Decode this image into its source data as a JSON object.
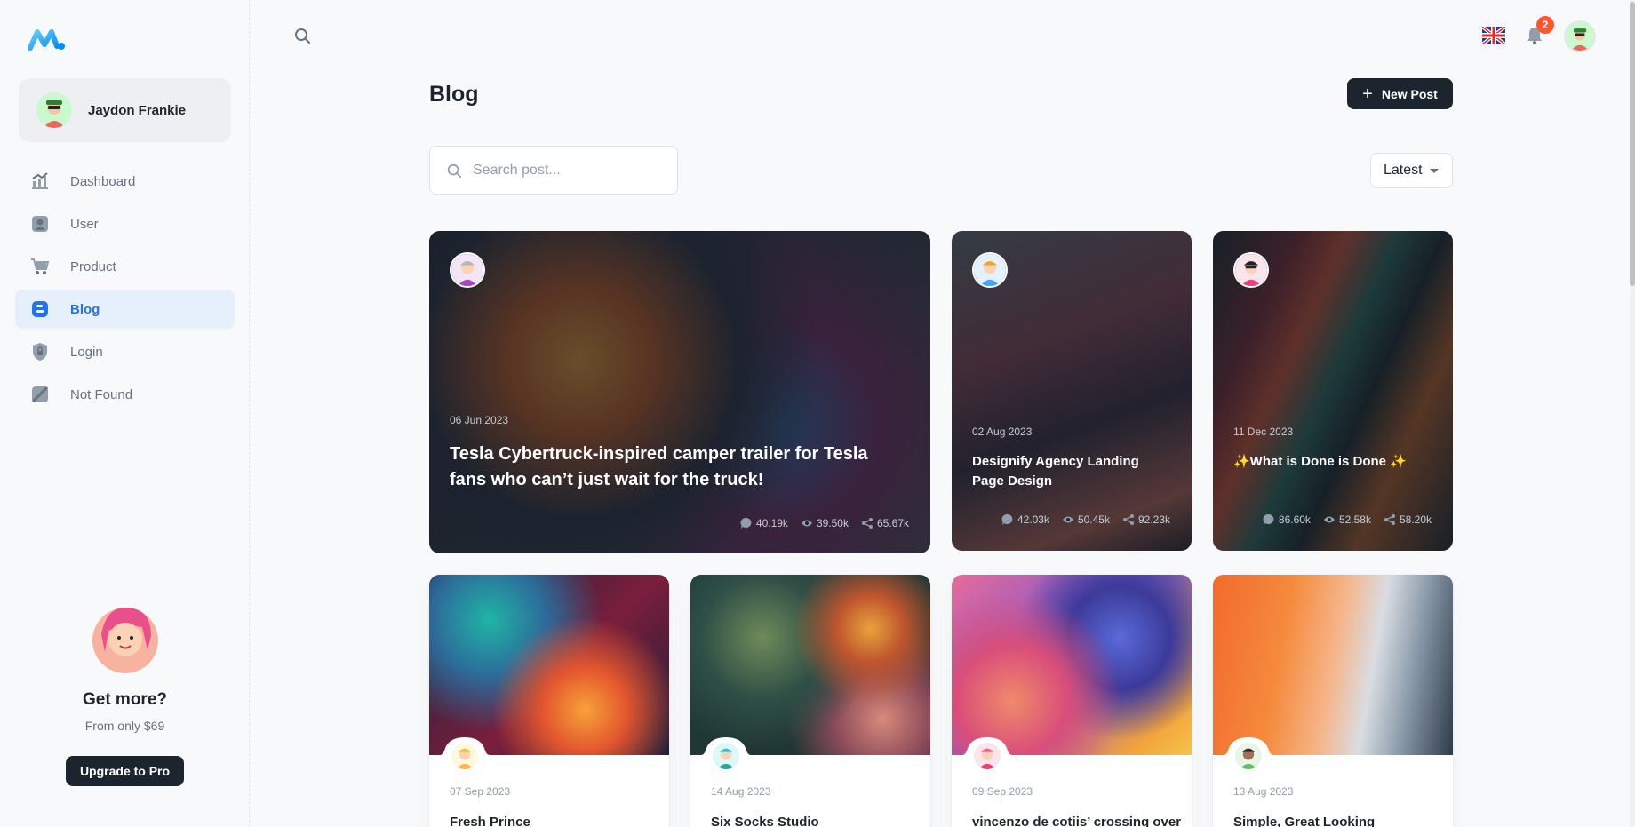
{
  "app": {
    "logo_name": "logo-icon"
  },
  "account": {
    "name": "Jaydon Frankie"
  },
  "sidebar": {
    "items": [
      {
        "label": "Dashboard",
        "icon": "chart-icon"
      },
      {
        "label": "User",
        "icon": "user-icon"
      },
      {
        "label": "Product",
        "icon": "cart-icon"
      },
      {
        "label": "Blog",
        "icon": "blog-icon",
        "active": true
      },
      {
        "label": "Login",
        "icon": "lock-icon"
      },
      {
        "label": "Not Found",
        "icon": "disabled-icon"
      }
    ]
  },
  "promo": {
    "heading": "Get more?",
    "subtext": "From only $69",
    "button_label": "Upgrade to Pro"
  },
  "header": {
    "notifications_count": "2"
  },
  "page": {
    "title": "Blog",
    "new_post_label": "New Post",
    "search_placeholder": "Search post...",
    "sort_value": "Latest"
  },
  "featured": [
    {
      "date": "06 Jun 2023",
      "title": "Tesla Cybertruck-inspired camper trailer for Tesla fans who can’t just wait for the truck!",
      "comments": "40.19k",
      "views": "39.50k",
      "shares": "65.67k"
    },
    {
      "date": "02 Aug 2023",
      "title": "Designify Agency Landing Page Design",
      "comments": "42.03k",
      "views": "50.45k",
      "shares": "92.23k"
    },
    {
      "date": "11 Dec 2023",
      "title": "✨What is Done is Done ✨",
      "comments": "86.60k",
      "views": "52.58k",
      "shares": "58.20k"
    }
  ],
  "posts": [
    {
      "date": "07 Sep 2023",
      "title": "Fresh Prince"
    },
    {
      "date": "14 Aug 2023",
      "title": "Six Socks Studio"
    },
    {
      "date": "09 Sep 2023",
      "title": "vincenzo de cotiis’ crossing over"
    },
    {
      "date": "13 Aug 2023",
      "title": "Simple, Great Looking"
    }
  ],
  "colors": {
    "primary": "#2671e3",
    "dark": "#1c252e",
    "badge": "#ff5630"
  }
}
